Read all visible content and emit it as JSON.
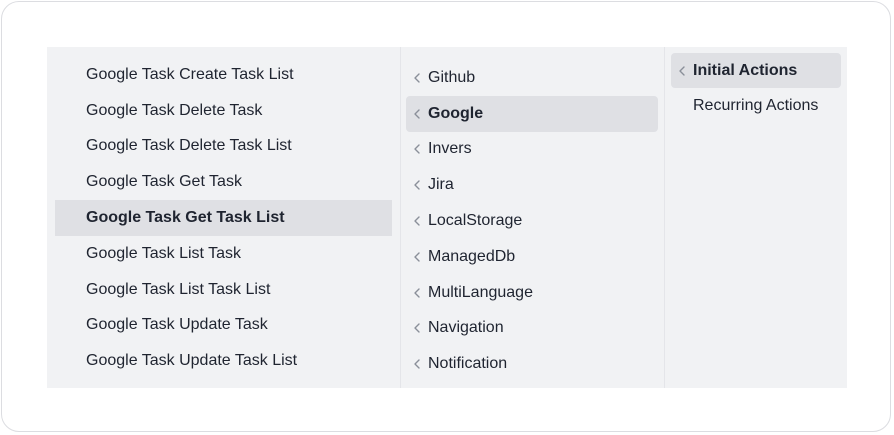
{
  "actions": {
    "items": [
      {
        "label": "Google Task Create Task List"
      },
      {
        "label": "Google Task Delete Task"
      },
      {
        "label": "Google Task Delete Task List"
      },
      {
        "label": "Google Task Get Task"
      },
      {
        "label": "Google Task Get Task List"
      },
      {
        "label": "Google Task List Task"
      },
      {
        "label": "Google Task List Task List"
      },
      {
        "label": "Google Task Update Task"
      },
      {
        "label": "Google Task Update Task List"
      }
    ],
    "selected": "Google Task Get Task List"
  },
  "providers": {
    "items": [
      {
        "label": "Github",
        "icon": "chevron-left-icon"
      },
      {
        "label": "Google",
        "icon": "chevron-left-icon"
      },
      {
        "label": "Invers",
        "icon": "chevron-left-icon"
      },
      {
        "label": "Jira",
        "icon": "chevron-left-icon"
      },
      {
        "label": "LocalStorage",
        "icon": "chevron-left-icon"
      },
      {
        "label": "ManagedDb",
        "icon": "chevron-left-icon"
      },
      {
        "label": "MultiLanguage",
        "icon": "chevron-left-icon"
      },
      {
        "label": "Navigation",
        "icon": "chevron-left-icon"
      },
      {
        "label": "Notification",
        "icon": "chevron-left-icon"
      }
    ],
    "selected": "Google"
  },
  "categories": {
    "items": [
      {
        "label": "Initial Actions",
        "icon": "chevron-left-icon"
      },
      {
        "label": "Recurring Actions"
      }
    ],
    "selected": "Initial Actions"
  },
  "colors": {
    "menu_background": "#f1f2f4",
    "active_background": "#dfe0e4",
    "text": "#1f2430",
    "chevron": "#8a8f99"
  }
}
